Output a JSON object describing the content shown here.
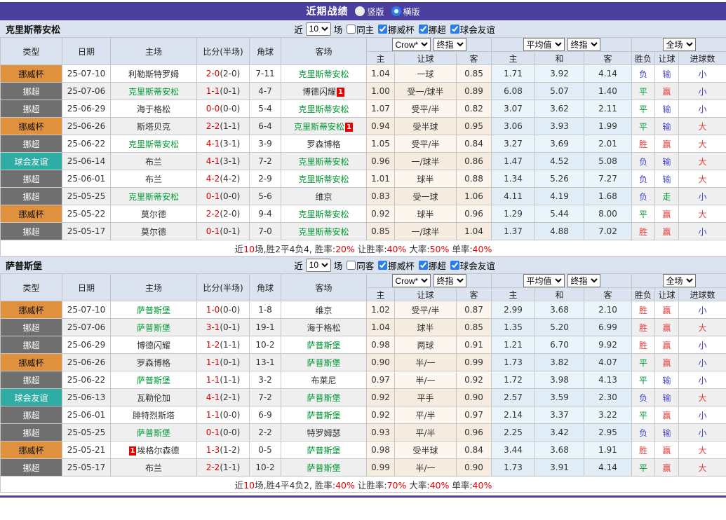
{
  "header": {
    "title": "近期战绩",
    "vertical_label": "竖版",
    "horizontal_label": "横版",
    "selected_layout": "横版"
  },
  "controls": {
    "near_label": "近",
    "near_value": "10",
    "games_label": "场",
    "cups": [
      "挪威杯",
      "挪超",
      "球会友谊"
    ]
  },
  "selects": {
    "crow": "Crow*",
    "final": "终指",
    "avg": "平均值",
    "full": "全场"
  },
  "columns": {
    "type": "类型",
    "date": "日期",
    "home": "主场",
    "score": "比分(半场)",
    "corner": "角球",
    "away": "客场",
    "h": "主",
    "handicap": "让球",
    "a": "客",
    "avg_h": "主",
    "avg_d": "和",
    "avg_a": "客",
    "wl": "胜负",
    "hc": "让球",
    "goals": "进球数"
  },
  "type_labels": {
    "cup": "挪威杯",
    "league": "挪超",
    "friendly": "球会友谊"
  },
  "colors": {
    "accent_purple": "#4a3f9f",
    "cup_orange": "#e0913d",
    "league_gray": "#6f6f6f",
    "friendly_teal": "#2fada4",
    "self_team_green": "#009933",
    "score_red": "#dd0000",
    "result_red": "#e04040",
    "result_blue": "#4444cc",
    "result_green": "#009933",
    "badge_red": "#e60000"
  },
  "sections": [
    {
      "team": "克里斯蒂安松",
      "same_label": "同主",
      "rows": [
        {
          "t": "cup",
          "d": "25-07-10",
          "h": {
            "n": "利勒斯特罗姆"
          },
          "s": [
            "2-0",
            "(2-0)"
          ],
          "c": "7-11",
          "a": {
            "n": "克里斯蒂安松",
            "self": true
          },
          "o": [
            "1.04",
            "一球",
            "0.85"
          ],
          "v": [
            "1.71",
            "3.92",
            "4.14"
          ],
          "r": [
            [
              "负",
              "b"
            ],
            [
              "输",
              "b"
            ],
            [
              "小",
              "b"
            ]
          ]
        },
        {
          "t": "league",
          "d": "25-07-06",
          "h": {
            "n": "克里斯蒂安松",
            "self": true
          },
          "s": [
            "1-1",
            "(0-1)"
          ],
          "c": "4-7",
          "a": {
            "n": "博德闪耀",
            "badge": "1",
            "bp": "after"
          },
          "o": [
            "1.00",
            "受一/球半",
            "0.89"
          ],
          "v": [
            "6.08",
            "5.07",
            "1.40"
          ],
          "r": [
            [
              "平",
              "g"
            ],
            [
              "赢",
              "r"
            ],
            [
              "小",
              "b"
            ]
          ]
        },
        {
          "t": "league",
          "d": "25-06-29",
          "h": {
            "n": "海于格松"
          },
          "s": [
            "0-0",
            "(0-0)"
          ],
          "c": "5-4",
          "a": {
            "n": "克里斯蒂安松",
            "self": true
          },
          "o": [
            "1.07",
            "受平/半",
            "0.82"
          ],
          "v": [
            "3.07",
            "3.62",
            "2.11"
          ],
          "r": [
            [
              "平",
              "g"
            ],
            [
              "输",
              "b"
            ],
            [
              "小",
              "b"
            ]
          ]
        },
        {
          "t": "cup",
          "d": "25-06-26",
          "h": {
            "n": "斯塔贝克"
          },
          "s": [
            "2-2",
            "(1-1)"
          ],
          "c": "6-4",
          "a": {
            "n": "克里斯蒂安松",
            "self": true,
            "badge": "1",
            "bp": "after"
          },
          "o": [
            "0.94",
            "受半球",
            "0.95"
          ],
          "v": [
            "3.06",
            "3.93",
            "1.99"
          ],
          "r": [
            [
              "平",
              "g"
            ],
            [
              "输",
              "b"
            ],
            [
              "大",
              "r"
            ]
          ]
        },
        {
          "t": "league",
          "d": "25-06-22",
          "h": {
            "n": "克里斯蒂安松",
            "self": true
          },
          "s": [
            "4-1",
            "(3-1)"
          ],
          "c": "3-9",
          "a": {
            "n": "罗森博格"
          },
          "o": [
            "1.05",
            "受平/半",
            "0.84"
          ],
          "v": [
            "3.27",
            "3.69",
            "2.01"
          ],
          "r": [
            [
              "胜",
              "r"
            ],
            [
              "赢",
              "r"
            ],
            [
              "大",
              "r"
            ]
          ]
        },
        {
          "t": "friendly",
          "d": "25-06-14",
          "h": {
            "n": "布兰"
          },
          "s": [
            "4-1",
            "(3-1)"
          ],
          "c": "7-2",
          "a": {
            "n": "克里斯蒂安松",
            "self": true
          },
          "o": [
            "0.96",
            "一/球半",
            "0.86"
          ],
          "v": [
            "1.47",
            "4.52",
            "5.08"
          ],
          "r": [
            [
              "负",
              "b"
            ],
            [
              "输",
              "b"
            ],
            [
              "大",
              "r"
            ]
          ]
        },
        {
          "t": "league",
          "d": "25-06-01",
          "h": {
            "n": "布兰"
          },
          "s": [
            "4-2",
            "(4-2)"
          ],
          "c": "2-9",
          "a": {
            "n": "克里斯蒂安松",
            "self": true
          },
          "o": [
            "1.01",
            "球半",
            "0.88"
          ],
          "v": [
            "1.34",
            "5.26",
            "7.27"
          ],
          "r": [
            [
              "负",
              "b"
            ],
            [
              "输",
              "b"
            ],
            [
              "大",
              "r"
            ]
          ]
        },
        {
          "t": "league",
          "d": "25-05-25",
          "h": {
            "n": "克里斯蒂安松",
            "self": true
          },
          "s": [
            "0-1",
            "(0-0)"
          ],
          "c": "5-6",
          "a": {
            "n": "维京"
          },
          "o": [
            "0.83",
            "受一球",
            "1.06"
          ],
          "v": [
            "4.11",
            "4.19",
            "1.68"
          ],
          "r": [
            [
              "负",
              "b"
            ],
            [
              "走",
              "g"
            ],
            [
              "小",
              "b"
            ]
          ]
        },
        {
          "t": "cup",
          "d": "25-05-22",
          "h": {
            "n": "莫尔德"
          },
          "s": [
            "2-2",
            "(2-0)"
          ],
          "c": "9-4",
          "a": {
            "n": "克里斯蒂安松",
            "self": true
          },
          "o": [
            "0.92",
            "球半",
            "0.96"
          ],
          "v": [
            "1.29",
            "5.44",
            "8.00"
          ],
          "r": [
            [
              "平",
              "g"
            ],
            [
              "赢",
              "r"
            ],
            [
              "大",
              "r"
            ]
          ]
        },
        {
          "t": "league",
          "d": "25-05-17",
          "h": {
            "n": "莫尔德"
          },
          "s": [
            "0-1",
            "(0-1)"
          ],
          "c": "7-0",
          "a": {
            "n": "克里斯蒂安松",
            "self": true
          },
          "o": [
            "0.85",
            "一/球半",
            "1.04"
          ],
          "v": [
            "1.37",
            "4.88",
            "7.02"
          ],
          "r": [
            [
              "胜",
              "r"
            ],
            [
              "赢",
              "r"
            ],
            [
              "小",
              "b"
            ]
          ]
        }
      ],
      "summary": [
        {
          "text": "近",
          "red": false
        },
        {
          "text": "10",
          "red": true
        },
        {
          "text": "场,胜2平4负4, 胜率:",
          "red": false
        },
        {
          "text": "20%",
          "red": true
        },
        {
          "text": " 让胜率:",
          "red": false
        },
        {
          "text": "40%",
          "red": true
        },
        {
          "text": " 大率:",
          "red": false
        },
        {
          "text": "50%",
          "red": true
        },
        {
          "text": " 单率:",
          "red": false
        },
        {
          "text": "40%",
          "red": true
        }
      ]
    },
    {
      "team": "萨普斯堡",
      "same_label": "同客",
      "rows": [
        {
          "t": "cup",
          "d": "25-07-10",
          "h": {
            "n": "萨普斯堡",
            "self": true
          },
          "s": [
            "1-0",
            "(0-0)"
          ],
          "c": "1-8",
          "a": {
            "n": "维京"
          },
          "o": [
            "1.02",
            "受平/半",
            "0.87"
          ],
          "v": [
            "2.99",
            "3.68",
            "2.10"
          ],
          "r": [
            [
              "胜",
              "r"
            ],
            [
              "赢",
              "r"
            ],
            [
              "小",
              "b"
            ]
          ]
        },
        {
          "t": "league",
          "d": "25-07-06",
          "h": {
            "n": "萨普斯堡",
            "self": true
          },
          "s": [
            "3-1",
            "(0-1)"
          ],
          "c": "19-1",
          "a": {
            "n": "海于格松"
          },
          "o": [
            "1.04",
            "球半",
            "0.85"
          ],
          "v": [
            "1.35",
            "5.20",
            "6.99"
          ],
          "r": [
            [
              "胜",
              "r"
            ],
            [
              "赢",
              "r"
            ],
            [
              "大",
              "r"
            ]
          ]
        },
        {
          "t": "league",
          "d": "25-06-29",
          "h": {
            "n": "博德闪耀"
          },
          "s": [
            "1-2",
            "(1-1)"
          ],
          "c": "10-2",
          "a": {
            "n": "萨普斯堡",
            "self": true
          },
          "o": [
            "0.98",
            "两球",
            "0.91"
          ],
          "v": [
            "1.21",
            "6.70",
            "9.92"
          ],
          "r": [
            [
              "胜",
              "r"
            ],
            [
              "赢",
              "r"
            ],
            [
              "小",
              "b"
            ]
          ]
        },
        {
          "t": "cup",
          "d": "25-06-26",
          "h": {
            "n": "罗森博格"
          },
          "s": [
            "1-1",
            "(0-1)"
          ],
          "c": "13-1",
          "a": {
            "n": "萨普斯堡",
            "self": true
          },
          "o": [
            "0.90",
            "半/一",
            "0.99"
          ],
          "v": [
            "1.73",
            "3.82",
            "4.07"
          ],
          "r": [
            [
              "平",
              "g"
            ],
            [
              "赢",
              "r"
            ],
            [
              "小",
              "b"
            ]
          ]
        },
        {
          "t": "league",
          "d": "25-06-22",
          "h": {
            "n": "萨普斯堡",
            "self": true
          },
          "s": [
            "1-1",
            "(1-1)"
          ],
          "c": "3-2",
          "a": {
            "n": "布莱尼"
          },
          "o": [
            "0.97",
            "半/一",
            "0.92"
          ],
          "v": [
            "1.72",
            "3.98",
            "4.13"
          ],
          "r": [
            [
              "平",
              "g"
            ],
            [
              "输",
              "b"
            ],
            [
              "小",
              "b"
            ]
          ]
        },
        {
          "t": "friendly",
          "d": "25-06-13",
          "h": {
            "n": "瓦勒伦加"
          },
          "s": [
            "4-1",
            "(2-1)"
          ],
          "c": "7-2",
          "a": {
            "n": "萨普斯堡",
            "self": true
          },
          "o": [
            "0.92",
            "平手",
            "0.90"
          ],
          "v": [
            "2.57",
            "3.59",
            "2.30"
          ],
          "r": [
            [
              "负",
              "b"
            ],
            [
              "输",
              "b"
            ],
            [
              "大",
              "r"
            ]
          ]
        },
        {
          "t": "league",
          "d": "25-06-01",
          "h": {
            "n": "腓特烈斯塔"
          },
          "s": [
            "1-1",
            "(0-0)"
          ],
          "c": "6-9",
          "a": {
            "n": "萨普斯堡",
            "self": true
          },
          "o": [
            "0.92",
            "平/半",
            "0.97"
          ],
          "v": [
            "2.14",
            "3.37",
            "3.22"
          ],
          "r": [
            [
              "平",
              "g"
            ],
            [
              "赢",
              "r"
            ],
            [
              "小",
              "b"
            ]
          ]
        },
        {
          "t": "league",
          "d": "25-05-25",
          "h": {
            "n": "萨普斯堡",
            "self": true
          },
          "s": [
            "0-1",
            "(0-0)"
          ],
          "c": "2-2",
          "a": {
            "n": "特罗姆瑟"
          },
          "o": [
            "0.93",
            "平/半",
            "0.96"
          ],
          "v": [
            "2.25",
            "3.42",
            "2.95"
          ],
          "r": [
            [
              "负",
              "b"
            ],
            [
              "输",
              "b"
            ],
            [
              "小",
              "b"
            ]
          ]
        },
        {
          "t": "cup",
          "d": "25-05-21",
          "h": {
            "n": "埃格尔森德",
            "badge": "1",
            "bp": "before"
          },
          "s": [
            "1-3",
            "(1-2)"
          ],
          "c": "0-5",
          "a": {
            "n": "萨普斯堡",
            "self": true
          },
          "o": [
            "0.98",
            "受半球",
            "0.84"
          ],
          "v": [
            "3.44",
            "3.68",
            "1.91"
          ],
          "r": [
            [
              "胜",
              "r"
            ],
            [
              "赢",
              "r"
            ],
            [
              "大",
              "r"
            ]
          ]
        },
        {
          "t": "league",
          "d": "25-05-17",
          "h": {
            "n": "布兰"
          },
          "s": [
            "2-2",
            "(1-1)"
          ],
          "c": "10-2",
          "a": {
            "n": "萨普斯堡",
            "self": true
          },
          "o": [
            "0.99",
            "半/一",
            "0.90"
          ],
          "v": [
            "1.73",
            "3.91",
            "4.14"
          ],
          "r": [
            [
              "平",
              "g"
            ],
            [
              "赢",
              "r"
            ],
            [
              "大",
              "r"
            ]
          ]
        }
      ],
      "summary": [
        {
          "text": "近",
          "red": false
        },
        {
          "text": "10",
          "red": true
        },
        {
          "text": "场,胜4平4负2, 胜率:",
          "red": false
        },
        {
          "text": "40%",
          "red": true
        },
        {
          "text": " 让胜率:",
          "red": false
        },
        {
          "text": "70%",
          "red": true
        },
        {
          "text": " 大率:",
          "red": false
        },
        {
          "text": "40%",
          "red": true
        },
        {
          "text": " 单率:",
          "red": false
        },
        {
          "text": "40%",
          "red": true
        }
      ]
    }
  ]
}
